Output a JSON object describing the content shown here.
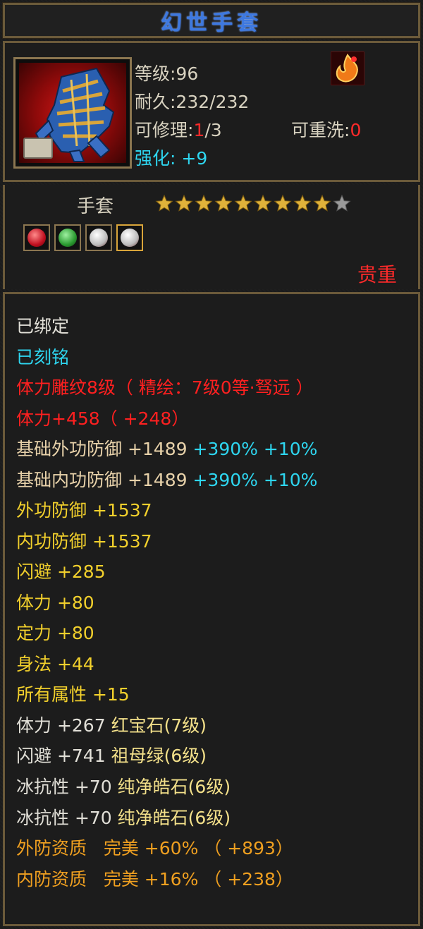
{
  "item": {
    "name": "幻世手套",
    "level": "等级:96",
    "durability": "耐久:232/232",
    "repair_label": "可修理:",
    "repair_current": "1",
    "repair_total": "/3",
    "rewash_label": "可重洗:",
    "rewash_value": "0",
    "enhance_label": "强化:",
    "enhance_value": "+9",
    "type": "手套",
    "stars_filled": 9,
    "stars_total": 10,
    "rarity": "贵重"
  },
  "colors": {
    "title": "#3d78e0",
    "star_filled": "#e0b23a",
    "star_empty": "#9a9a9a",
    "gem_red": "#e8222e",
    "gem_green": "#2ea83a",
    "gem_white": "#dcdcdc"
  },
  "gems": [
    "ruby-gem-icon",
    "emerald-gem-icon",
    "white-gem-icon",
    "white-gem-icon"
  ],
  "attributes": {
    "bound": "已绑定",
    "engraved": "已刻铭",
    "carving": "体力雕纹8级（ 精绘：7级0等·驽远 ）",
    "stamina_main": "体力+458（ +248）",
    "base_ext_def": "基础外功防御 +1489",
    "base_ext_def_pct": "+390%",
    "base_ext_def_extra": "+10%",
    "base_int_def": "基础内功防御 +1489",
    "base_int_def_pct": "+390%",
    "base_int_def_extra": "+10%",
    "ext_def": "外功防御 +1537",
    "int_def": "内功防御 +1537",
    "dodge": "闪避 +285",
    "stamina": "体力 +80",
    "focus": "定力 +80",
    "agility": "身法 +44",
    "all_attr": "所有属性 +15",
    "gem1_stat": "体力 +267",
    "gem1_name": "红宝石(7级)",
    "gem2_stat": "闪避 +741",
    "gem2_name": "祖母绿(6级)",
    "gem3_stat": "冰抗性 +70",
    "gem3_name": "纯净皓石(6级)",
    "gem4_stat": "冰抗性 +70",
    "gem4_name": "纯净皓石(6级)",
    "ext_quality_label": "外防资质",
    "ext_quality": "完美 +60% （ +893）",
    "int_quality_label": "内防资质",
    "int_quality": "完美 +16% （ +238）"
  }
}
